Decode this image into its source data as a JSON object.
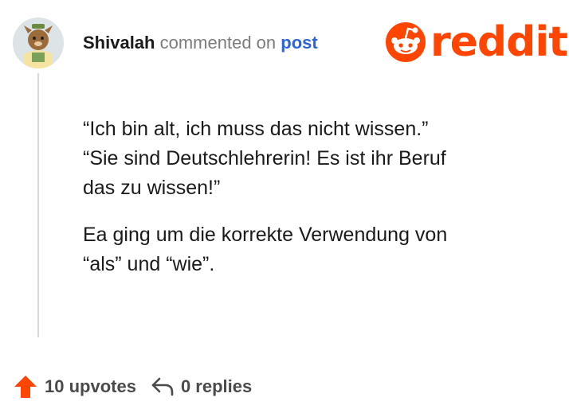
{
  "comment": {
    "username": "Shivalah",
    "action": "commented on",
    "target": "post",
    "paragraphs": [
      [
        "“Ich bin alt, ich muss das nicht wissen.”",
        "“Sie sind Deutschlehrerin! Es ist ihr Beruf",
        "das zu wissen!”"
      ],
      [
        "Ea ging um die korrekte Verwendung von",
        "“als” und “wie”."
      ]
    ]
  },
  "brand": {
    "name": "reddit",
    "color": "#ff4500"
  },
  "footer": {
    "upvotes_label": "10 upvotes",
    "replies_label": "0 replies"
  },
  "icons": {
    "upvote": "upvote-arrow-icon",
    "reply": "reply-arrow-icon",
    "logo": "reddit-snoo-icon"
  }
}
